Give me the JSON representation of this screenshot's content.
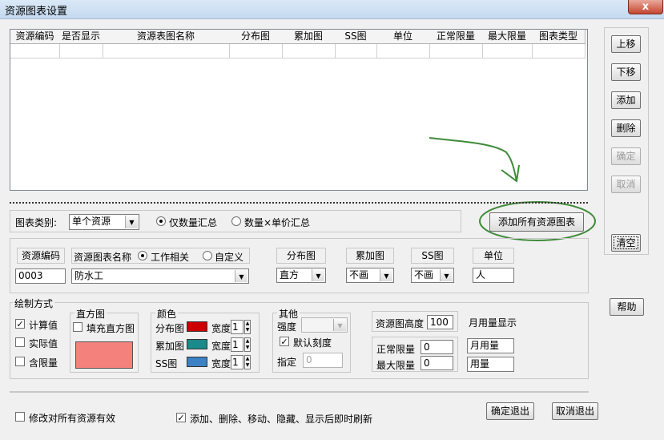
{
  "window": {
    "title": "资源图表设置",
    "close_glyph": "x"
  },
  "grid": {
    "columns": [
      "资源编码",
      "是否显示",
      "资源表图名称",
      "分布图",
      "累加图",
      "SS图",
      "单位",
      "正常限量",
      "最大限量",
      "图表类型"
    ]
  },
  "side_buttons": {
    "up": "上移",
    "down": "下移",
    "add": "添加",
    "delete": "删除",
    "confirm": "确定",
    "cancel": "取消",
    "clear": "清空",
    "help": "帮助"
  },
  "chart_category": {
    "label": "图表类别:",
    "value": "单个资源",
    "radio_qty": "仅数量汇总",
    "radio_qty_price": "数量×单价汇总",
    "add_all_button": "添加所有资源图表"
  },
  "resource": {
    "code_header": "资源编码",
    "code_value": "0003",
    "name_header": "资源图表名称",
    "radio_work": "工作相关",
    "radio_custom": "自定义",
    "name_value": "防水工",
    "dist_header": "分布图",
    "dist_value": "直方",
    "cum_header": "累加图",
    "cum_value": "不画",
    "ss_header": "SS图",
    "ss_value": "不画",
    "unit_header": "单位",
    "unit_value": "人"
  },
  "draw": {
    "legend": "绘制方式",
    "calc": "计算值",
    "actual": "实际值",
    "limit": "含限量",
    "histogram_legend": "直方图",
    "fill_hist": "填充直方图",
    "fill_color": "#f4817c",
    "color_legend": "颜色",
    "dist_label": "分布图",
    "cum_label": "累加图",
    "ss_label": "SS图",
    "width_label": "宽度",
    "width_value": "1",
    "dist_color": "#cc0000",
    "cum_color": "#1a8a8a",
    "ss_color": "#3b82c4",
    "other_legend": "其他",
    "intensity_label": "强度",
    "default_scale": "默认刻度",
    "specify_label": "指定",
    "specify_value": "0",
    "res_height_label": "资源图高度",
    "res_height_value": "100",
    "normal_limit_label": "正常限量",
    "normal_limit_value": "0",
    "max_limit_label": "最大限量",
    "max_limit_value": "0",
    "monthly_display_label": "月用量显示",
    "monthly_value": "月用量",
    "usage_value": "用量"
  },
  "bottom": {
    "apply_all": "修改对所有资源有效",
    "refresh_after": "添加、删除、移动、隐藏、显示后即时刷新",
    "ok_exit": "确定退出",
    "cancel_exit": "取消退出"
  },
  "check_glyph": "✓",
  "arrow_glyph": "▼",
  "spin_up": "▲",
  "spin_down": "▼"
}
